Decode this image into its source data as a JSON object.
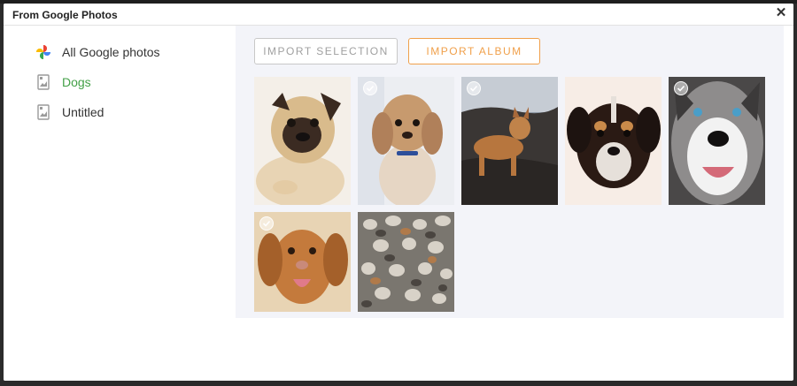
{
  "dialog": {
    "title": "From Google Photos",
    "close_icon": "close-icon"
  },
  "sidebar": {
    "items": [
      {
        "label": "All Google photos",
        "icon": "google-photos-icon",
        "active": false
      },
      {
        "label": "Dogs",
        "icon": "album-icon",
        "active": true
      },
      {
        "label": "Untitled",
        "icon": "album-icon",
        "active": false
      }
    ]
  },
  "toolbar": {
    "import_selection_label": "IMPORT SELECTION",
    "import_album_label": "IMPORT ALBUM"
  },
  "colors": {
    "accent_orange": "#f0a04b",
    "active_green": "#43a047",
    "content_bg": "#f3f4f9"
  },
  "photos": [
    {
      "subject": "pug",
      "selected": false
    },
    {
      "subject": "cockapoo",
      "selected": true
    },
    {
      "subject": "chihuahua-on-rocks",
      "selected": true
    },
    {
      "subject": "tricolor-puppy",
      "selected": false
    },
    {
      "subject": "blue-eyed-dog",
      "selected": true
    },
    {
      "subject": "retriever",
      "selected": true
    },
    {
      "subject": "dog-pack",
      "selected": false
    }
  ]
}
